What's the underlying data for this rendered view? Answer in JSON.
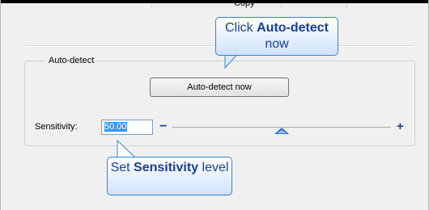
{
  "top": {
    "copy_label": "Copy"
  },
  "group": {
    "title": "Auto-detect",
    "button_label": "Auto-detect now"
  },
  "sensitivity": {
    "label": "Sensitivity:",
    "value": "50.00",
    "minus_symbol": "−",
    "plus_symbol": "+",
    "slider_level": 0.5
  },
  "callouts": {
    "first": {
      "pre": "Click ",
      "bold": "Auto-detect",
      "post": " now"
    },
    "second": {
      "pre": "Set ",
      "bold": "Sensitivity",
      "post": " level"
    }
  },
  "colors": {
    "accent": "#2a73c8",
    "callout_text": "#1a3f95",
    "callout_border": "#3a7fd5",
    "selection": "#3399ff"
  }
}
